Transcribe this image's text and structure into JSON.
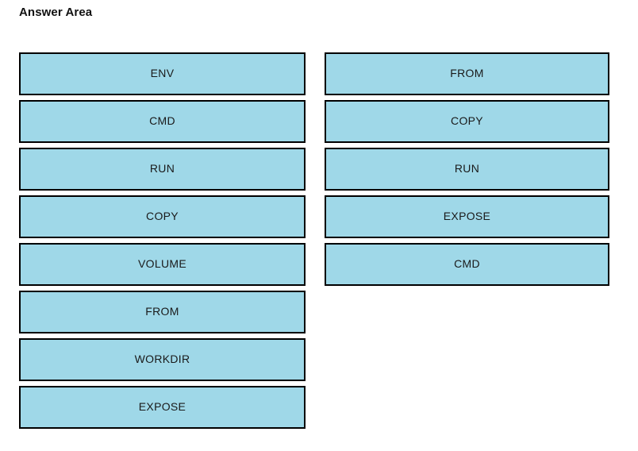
{
  "page": {
    "title": "Answer Area",
    "background_color": "#ffffff"
  },
  "style": {
    "tile_fill_color": "#9FD8E8",
    "tile_border_color": "#000000",
    "text_color": "#1a1a1a"
  },
  "columns": [
    {
      "name": "source-list",
      "items": [
        {
          "label": "ENV"
        },
        {
          "label": "CMD"
        },
        {
          "label": "RUN"
        },
        {
          "label": "COPY"
        },
        {
          "label": "VOLUME"
        },
        {
          "label": "FROM"
        },
        {
          "label": "WORKDIR"
        },
        {
          "label": "EXPOSE"
        }
      ]
    },
    {
      "name": "answer-list",
      "items": [
        {
          "label": "FROM"
        },
        {
          "label": "COPY"
        },
        {
          "label": "RUN"
        },
        {
          "label": "EXPOSE"
        },
        {
          "label": "CMD"
        }
      ]
    }
  ]
}
